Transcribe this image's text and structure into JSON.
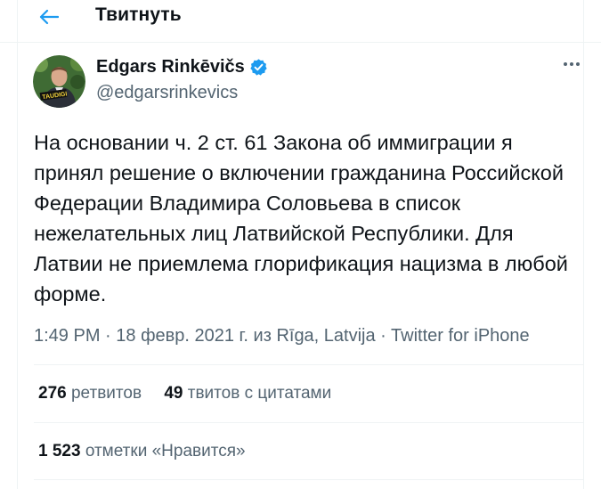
{
  "header": {
    "title": "Твитнуть"
  },
  "tweet": {
    "author_name": "Edgars Rinkēvičs",
    "author_handle": "@edgarsrinkevics",
    "avatar_badge": "TAUDIGI",
    "text": "На основании ч. 2 ст. 61 Закона об иммиграции я принял решение о включении гражданина Российской Федерации Владимира Соловьева в список нежелательных лиц Латвийской Республики. Для Латвии не приемлема глорификация нацизма в любой форме.",
    "time": "1:49 PM",
    "sep1": " · ",
    "date": "18 февр. 2021 г.",
    "location_prefix": " из ",
    "location": "Rīga, Latvija",
    "sep2": " · ",
    "source": "Twitter for iPhone"
  },
  "stats": {
    "retweets_count": "276",
    "retweets_label": "ретвитов",
    "quotes_count": "49",
    "quotes_label": "твитов с цитатами",
    "likes_count": "1 523",
    "likes_label": "отметки «Нравится»"
  },
  "colors": {
    "accent": "#1d9bf0",
    "text_primary": "#0f1419",
    "text_secondary": "#536471",
    "divider": "#eff3f4"
  },
  "icons": {
    "back": "arrow-left-icon",
    "verified": "verified-badge-icon",
    "more": "more-horizontal-icon"
  }
}
